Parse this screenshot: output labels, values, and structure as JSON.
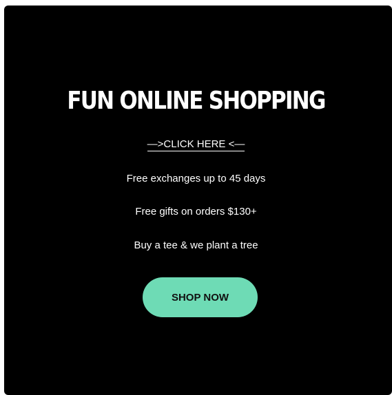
{
  "banner": {
    "title": "FUN ONLINE SHOPPING",
    "link_label": "—>CLICK HERE <—",
    "perks": [
      "Free exchanges up to 45 days",
      "Free gifts on orders $130+",
      "Buy a tee & we plant a tree"
    ],
    "button_label": "SHOP NOW"
  },
  "colors": {
    "background": "#000000",
    "text": "#ffffff",
    "button": "#6edbb5",
    "button_text": "#111111"
  }
}
